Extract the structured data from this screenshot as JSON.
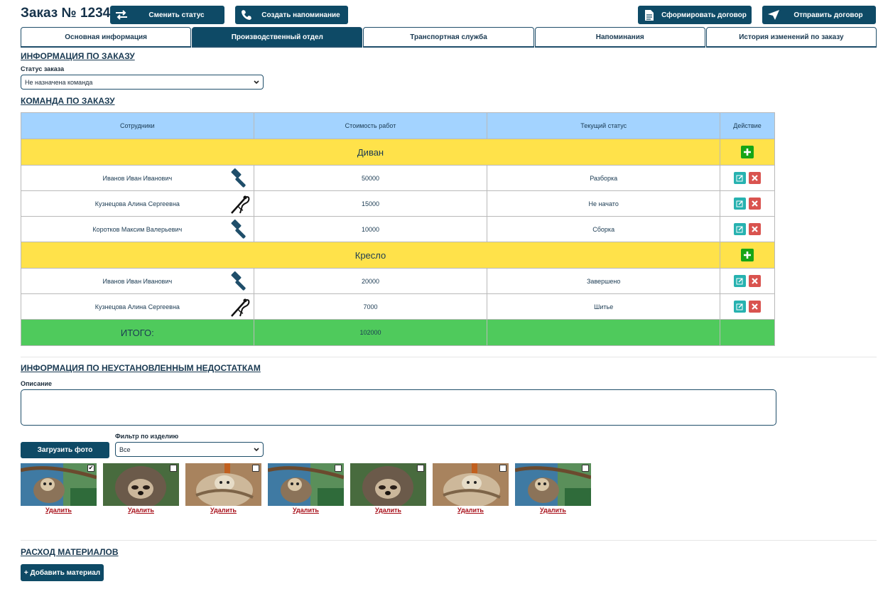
{
  "header": {
    "title": "Заказ № 1234",
    "change_status": "Сменить статус",
    "create_reminder": "Создать напоминание",
    "form_contract": "Сформировать договор",
    "send_contract": "Отправить договор"
  },
  "tabs": [
    {
      "label": "Основная информация",
      "active": false
    },
    {
      "label": "Производственный отдел",
      "active": true
    },
    {
      "label": "Транспортная служба",
      "active": false
    },
    {
      "label": "Напоминания",
      "active": false
    },
    {
      "label": "История изменений по заказу",
      "active": false
    }
  ],
  "order_info": {
    "title": "ИНФОРМАЦИЯ ПО ЗАКАЗУ",
    "status_label": "Статус заказа",
    "status_value": "Не назначена команда"
  },
  "team": {
    "title": "КОМАНДА ПО ЗАКАЗУ",
    "headers": [
      "Сотрудники",
      "Стоимость работ",
      "Текущий статус",
      "Действие"
    ],
    "groups": [
      {
        "name": "Диван",
        "rows": [
          {
            "employee": "Иванов Иван Иванович",
            "tool": "hammer-icon",
            "cost": "50000",
            "status": "Разборка"
          },
          {
            "employee": "Кузнецова Алина Сергеевна",
            "tool": "sewing-icon",
            "cost": "15000",
            "status": "Не начато"
          },
          {
            "employee": "Коротков Максим Валерьевич",
            "tool": "hammer-icon",
            "cost": "10000",
            "status": "Сборка"
          }
        ]
      },
      {
        "name": "Кресло",
        "rows": [
          {
            "employee": "Иванов Иван Иванович",
            "tool": "hammer-icon",
            "cost": "20000",
            "status": "Завершено"
          },
          {
            "employee": "Кузнецова Алина Сергеевна",
            "tool": "sewing-icon",
            "cost": "7000",
            "status": "Шитье"
          }
        ]
      }
    ],
    "total_label": "ИТОГО:",
    "total_value": "102000"
  },
  "defects": {
    "title": "ИНФОРМАЦИЯ ПО НЕУСТАНОВЛЕННЫМ НЕДОСТАТКАМ",
    "description_label": "Описание",
    "upload_button": "Загрузить фото",
    "filter_label": "Фильтр по изделию",
    "filter_value": "Все",
    "photos": [
      {
        "variant": "sloth-hanging",
        "checked": true,
        "delete": "Удалить"
      },
      {
        "variant": "sloth-face",
        "checked": false,
        "delete": "Удалить"
      },
      {
        "variant": "sloth-tree",
        "checked": false,
        "delete": "Удалить"
      },
      {
        "variant": "sloth-hanging",
        "checked": false,
        "delete": "Удалить"
      },
      {
        "variant": "sloth-face",
        "checked": false,
        "delete": "Удалить"
      },
      {
        "variant": "sloth-tree",
        "checked": false,
        "delete": "Удалить"
      },
      {
        "variant": "sloth-hanging",
        "checked": false,
        "delete": "Удалить"
      }
    ]
  },
  "materials": {
    "title": "РАСХОД МАТЕРИАЛОВ",
    "add_button": "+ Добавить материал"
  },
  "colors": {
    "primary": "#0e4a66",
    "header_row": "#a3d3ff",
    "group_row": "#ffe24a",
    "total_row": "#4fca5c",
    "edit": "#27b2b0",
    "delete": "#d9534f",
    "add": "#16a516"
  }
}
